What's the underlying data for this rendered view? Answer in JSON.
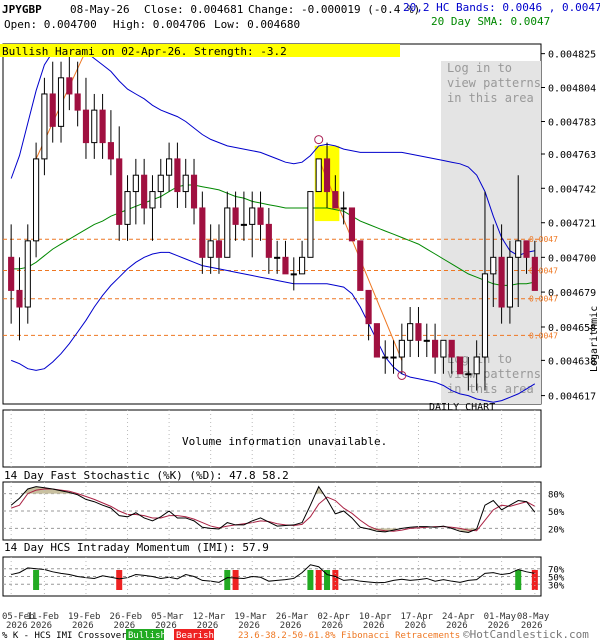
{
  "header": {
    "symbol": "JPYGBP",
    "date": "08-May-26",
    "close_label": "Close: 0.004681",
    "change_label": "Change: -0.000019 (-0.4 %)",
    "open_label": "Open: 0.004700",
    "high_label": "High: 0.004706",
    "low_label": "Low: 0.004680",
    "bands_label": "20,2 HC Bands: 0.0046 , 0.0047",
    "sma_label": "20 Day SMA: 0.0047",
    "pattern_label": "Bullish Harami on 02-Apr-26. Strength: -3.2",
    "login_text": [
      "Log in to",
      "view patterns",
      "in this area"
    ],
    "daily_chart_label": "DAILY CHART",
    "logarithmic_label": "Logarithmic"
  },
  "volume": {
    "text": "Volume information unavailable."
  },
  "stochastic": {
    "title": "14 Day Fast Stochastic (%K) (%D): 47.8 58.2",
    "k_value": 47.8,
    "d_value": 58.2
  },
  "momentum": {
    "title": "14 Day HCS Intraday Momentum (IMI): 57.9",
    "value": 57.9
  },
  "footer": {
    "legend_prefix": "% K - HCS IMI Crossover:",
    "bullish": "Bullish",
    "bearish": "Bearish",
    "fib_text": "23.6-38.2-50-61.8% Fibonacci Retracements",
    "copyright": "©HotCandlestick.com"
  },
  "colors": {
    "bull": "#ffffff",
    "bear": "#a01040",
    "bands": "#0000cc",
    "sma": "#008800",
    "fib": "#ee7722",
    "highlight": "#ffff00",
    "bullish_marker": "#22aa22",
    "bearish_marker": "#ee2222"
  },
  "chart_data": {
    "type": "candlestick",
    "title": "JPYGBP",
    "y_scale": "log",
    "ylim": [
      0.004612,
      0.004831
    ],
    "y_ticks": [
      "0.004825",
      "0.004804",
      "0.004783",
      "0.004763",
      "0.004742",
      "0.004721",
      "0.004700",
      "0.004679",
      "0.004658",
      "0.004638",
      "0.004617"
    ],
    "fib_levels": [
      "0.0047",
      "0.0047",
      "0.0047",
      "0.0047"
    ],
    "fib_values": [
      0.004711,
      0.004692,
      0.004675,
      0.004653
    ],
    "x_ticks": [
      "05-Feb 2026",
      "11-Feb 2026",
      "19-Feb 2026",
      "26-Feb 2026",
      "05-Mar 2026",
      "12-Mar 2026",
      "19-Mar 2026",
      "26-Mar 2026",
      "02-Apr 2026",
      "10-Apr 2026",
      "17-Apr 2026",
      "24-Apr 2026",
      "01-May 2026",
      "08-May 2026"
    ],
    "candles": [
      [
        0.0047,
        0.00472,
        0.00466,
        0.00468
      ],
      [
        0.00468,
        0.0047,
        0.00465,
        0.00467
      ],
      [
        0.00467,
        0.00472,
        0.00466,
        0.00471
      ],
      [
        0.00471,
        0.00477,
        0.0047,
        0.00476
      ],
      [
        0.00476,
        0.00481,
        0.00475,
        0.0048
      ],
      [
        0.0048,
        0.00482,
        0.00477,
        0.00478
      ],
      [
        0.00478,
        0.00482,
        0.00477,
        0.00481
      ],
      [
        0.00481,
        0.00483,
        0.00479,
        0.0048
      ],
      [
        0.0048,
        0.00482,
        0.00478,
        0.00479
      ],
      [
        0.00479,
        0.00481,
        0.00476,
        0.00477
      ],
      [
        0.00477,
        0.0048,
        0.00476,
        0.00479
      ],
      [
        0.00479,
        0.0048,
        0.00476,
        0.00477
      ],
      [
        0.00477,
        0.00479,
        0.00475,
        0.00476
      ],
      [
        0.00476,
        0.00478,
        0.00471,
        0.00472
      ],
      [
        0.00472,
        0.00475,
        0.00471,
        0.00474
      ],
      [
        0.00474,
        0.00476,
        0.00472,
        0.00475
      ],
      [
        0.00475,
        0.00476,
        0.00472,
        0.00473
      ],
      [
        0.00473,
        0.00475,
        0.00471,
        0.00474
      ],
      [
        0.00474,
        0.00476,
        0.00473,
        0.00475
      ],
      [
        0.00475,
        0.00477,
        0.00474,
        0.00476
      ],
      [
        0.00476,
        0.00477,
        0.00473,
        0.00474
      ],
      [
        0.00474,
        0.00476,
        0.00473,
        0.00475
      ],
      [
        0.00475,
        0.00476,
        0.00472,
        0.00473
      ],
      [
        0.00473,
        0.00474,
        0.00469,
        0.0047
      ],
      [
        0.0047,
        0.00472,
        0.00469,
        0.00471
      ],
      [
        0.00471,
        0.00472,
        0.00469,
        0.0047
      ],
      [
        0.0047,
        0.00474,
        0.0047,
        0.00473
      ],
      [
        0.00473,
        0.00474,
        0.00471,
        0.00472
      ],
      [
        0.00472,
        0.00474,
        0.00471,
        0.00472
      ],
      [
        0.00472,
        0.00474,
        0.0047,
        0.00473
      ],
      [
        0.00473,
        0.00474,
        0.00471,
        0.00472
      ],
      [
        0.00472,
        0.00473,
        0.00469,
        0.0047
      ],
      [
        0.0047,
        0.00471,
        0.00469,
        0.0047
      ],
      [
        0.0047,
        0.00471,
        0.00469,
        0.00469
      ],
      [
        0.00469,
        0.0047,
        0.00468,
        0.00469
      ],
      [
        0.00469,
        0.00471,
        0.00469,
        0.0047
      ],
      [
        0.0047,
        0.00474,
        0.0047,
        0.00474
      ],
      [
        0.00474,
        0.00476,
        0.00474,
        0.00476
      ],
      [
        0.00476,
        0.00477,
        0.00473,
        0.00474
      ],
      [
        0.00474,
        0.00475,
        0.00473,
        0.00473
      ],
      [
        0.00473,
        0.00474,
        0.00472,
        0.00473
      ],
      [
        0.00473,
        0.00473,
        0.00471,
        0.00471
      ],
      [
        0.00471,
        0.00471,
        0.00468,
        0.00468
      ],
      [
        0.00468,
        0.00468,
        0.00465,
        0.00466
      ],
      [
        0.00466,
        0.00466,
        0.00464,
        0.00464
      ],
      [
        0.00464,
        0.00465,
        0.00463,
        0.00464
      ],
      [
        0.00464,
        0.00465,
        0.00463,
        0.00464
      ],
      [
        0.00464,
        0.00466,
        0.00463,
        0.00465
      ],
      [
        0.00465,
        0.00467,
        0.00464,
        0.00466
      ],
      [
        0.00466,
        0.00467,
        0.00464,
        0.00465
      ],
      [
        0.00465,
        0.00466,
        0.00464,
        0.00465
      ],
      [
        0.00465,
        0.00466,
        0.00463,
        0.00464
      ],
      [
        0.00464,
        0.00465,
        0.00463,
        0.00465
      ],
      [
        0.00465,
        0.00465,
        0.00463,
        0.00464
      ],
      [
        0.00464,
        0.00464,
        0.00463,
        0.00463
      ],
      [
        0.00463,
        0.00464,
        0.00462,
        0.00463
      ],
      [
        0.00463,
        0.00465,
        0.00462,
        0.00464
      ],
      [
        0.00464,
        0.00474,
        0.00462,
        0.00469
      ],
      [
        0.00469,
        0.00472,
        0.00467,
        0.0047
      ],
      [
        0.0047,
        0.00472,
        0.00466,
        0.00467
      ],
      [
        0.00467,
        0.00471,
        0.00466,
        0.0047
      ],
      [
        0.0047,
        0.00475,
        0.00467,
        0.00471
      ],
      [
        0.00471,
        0.00471,
        0.00469,
        0.0047
      ],
      [
        0.0047,
        0.00471,
        0.00468,
        0.00468
      ]
    ],
    "upper_band": [
      0.004748,
      0.004762,
      0.004782,
      0.004802,
      0.004818,
      0.004826,
      0.00483,
      0.00483,
      0.004829,
      0.004826,
      0.004822,
      0.004818,
      0.004814,
      0.004808,
      0.004803,
      0.0048,
      0.004797,
      0.004793,
      0.00479,
      0.004788,
      0.004786,
      0.004783,
      0.004779,
      0.004775,
      0.004772,
      0.00477,
      0.004768,
      0.004767,
      0.004766,
      0.004765,
      0.004764,
      0.004762,
      0.00476,
      0.004758,
      0.004757,
      0.004758,
      0.004762,
      0.004768,
      0.004769,
      0.004768,
      0.004766,
      0.004765,
      0.004764,
      0.004764,
      0.004764,
      0.004764,
      0.004764,
      0.004764,
      0.004763,
      0.004762,
      0.004761,
      0.00476,
      0.004759,
      0.004758,
      0.004757,
      0.004755,
      0.00475,
      0.00474,
      0.004725,
      0.004712,
      0.004704,
      0.004701,
      0.004703,
      0.004704
    ],
    "lower_band": [
      0.004638,
      0.004636,
      0.004633,
      0.004632,
      0.004633,
      0.004637,
      0.004642,
      0.004648,
      0.004655,
      0.004662,
      0.00467,
      0.004677,
      0.004683,
      0.004688,
      0.004693,
      0.004697,
      0.0047,
      0.004702,
      0.004703,
      0.004703,
      0.004701,
      0.004699,
      0.004697,
      0.004695,
      0.004694,
      0.004693,
      0.004692,
      0.004691,
      0.00469,
      0.004689,
      0.004688,
      0.004687,
      0.004686,
      0.004685,
      0.004684,
      0.004684,
      0.004684,
      0.004684,
      0.004684,
      0.004683,
      0.004682,
      0.004678,
      0.00467,
      0.00466,
      0.00465,
      0.00464,
      0.004634,
      0.00463,
      0.004628,
      0.004627,
      0.004626,
      0.004625,
      0.004623,
      0.00462,
      0.004618,
      0.004617,
      0.004615,
      0.004614,
      0.004613,
      0.004614,
      0.004616,
      0.004618,
      0.004621,
      0.004624
    ],
    "sma": [
      0.004693,
      0.004693,
      0.004694,
      0.004697,
      0.004701,
      0.004705,
      0.004708,
      0.004711,
      0.004714,
      0.004717,
      0.00472,
      0.004722,
      0.004725,
      0.004727,
      0.004729,
      0.004731,
      0.004733,
      0.004735,
      0.004737,
      0.00474,
      0.004743,
      0.004744,
      0.004744,
      0.004743,
      0.004742,
      0.004741,
      0.004739,
      0.004737,
      0.004736,
      0.004734,
      0.004733,
      0.004732,
      0.004731,
      0.00473,
      0.00473,
      0.00473,
      0.00473,
      0.00473,
      0.00473,
      0.004729,
      0.004728,
      0.004725,
      0.004722,
      0.00472,
      0.004718,
      0.004716,
      0.004714,
      0.004712,
      0.00471,
      0.004708,
      0.004705,
      0.004702,
      0.004699,
      0.004696,
      0.004693,
      0.00469,
      0.004688,
      0.004686,
      0.004684,
      0.004683,
      0.004683,
      0.004684,
      0.004684,
      0.004685
    ],
    "stoch_k": [
      60,
      72,
      88,
      92,
      90,
      88,
      85,
      82,
      78,
      70,
      66,
      60,
      55,
      42,
      40,
      47,
      38,
      33,
      40,
      50,
      38,
      38,
      33,
      22,
      20,
      19,
      30,
      26,
      26,
      33,
      38,
      31,
      24,
      25,
      26,
      30,
      60,
      92,
      70,
      45,
      50,
      38,
      22,
      19,
      15,
      14,
      17,
      20,
      22,
      23,
      23,
      22,
      24,
      20,
      15,
      13,
      19,
      60,
      68,
      52,
      60,
      68,
      66,
      48
    ],
    "stoch_d": [
      55,
      60,
      80,
      86,
      88,
      88,
      86,
      84,
      80,
      75,
      70,
      64,
      58,
      50,
      44,
      44,
      42,
      38,
      38,
      42,
      42,
      40,
      36,
      30,
      24,
      21,
      24,
      26,
      28,
      30,
      33,
      32,
      28,
      26,
      25,
      27,
      40,
      62,
      74,
      68,
      55,
      46,
      34,
      24,
      18,
      16,
      15,
      17,
      20,
      21,
      22,
      23,
      23,
      22,
      20,
      17,
      16,
      34,
      52,
      60,
      58,
      62,
      66,
      58
    ],
    "imi": [
      55,
      60,
      72,
      70,
      68,
      62,
      58,
      55,
      50,
      47,
      45,
      52,
      48,
      44,
      47,
      55,
      53,
      50,
      45,
      48,
      44,
      55,
      50,
      40,
      38,
      35,
      47,
      46,
      45,
      50,
      48,
      38,
      40,
      42,
      45,
      60,
      80,
      75,
      55,
      50,
      40,
      42,
      38,
      36,
      34,
      35,
      40,
      43,
      40,
      42,
      45,
      38,
      42,
      38,
      35,
      40,
      42,
      58,
      60,
      55,
      58,
      68,
      62,
      58
    ],
    "crossovers": [
      {
        "index": 3,
        "type": "bullish"
      },
      {
        "index": 13,
        "type": "bearish"
      },
      {
        "index": 26,
        "type": "bullish"
      },
      {
        "index": 27,
        "type": "bearish"
      },
      {
        "index": 36,
        "type": "bullish"
      },
      {
        "index": 37,
        "type": "bearish"
      },
      {
        "index": 38,
        "type": "bullish"
      },
      {
        "index": 39,
        "type": "bearish"
      },
      {
        "index": 61,
        "type": "bullish"
      },
      {
        "index": 63,
        "type": "bearish"
      }
    ],
    "stoch_ticks": [
      "80%",
      "50%",
      "20%"
    ],
    "imi_ticks": [
      "70%",
      "50%",
      "30%"
    ]
  }
}
